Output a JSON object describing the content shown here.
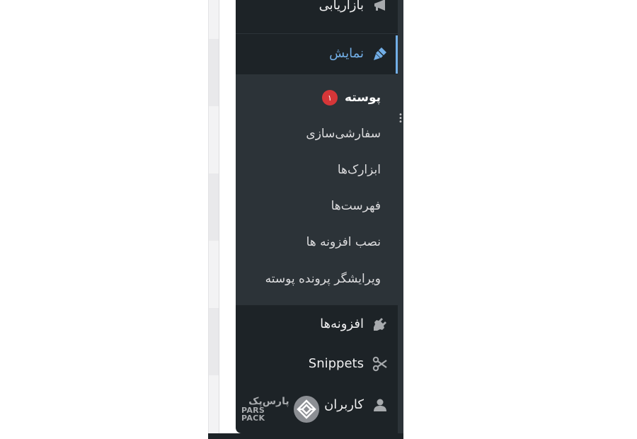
{
  "menu": {
    "top_item": {
      "label": "بازاریابی",
      "icon": "megaphone-icon"
    },
    "active_item": {
      "label": "نمایش",
      "icon": "paintbrush-icon"
    },
    "submenu": [
      {
        "label": "پوسته",
        "badge": "۱"
      },
      {
        "label": "سفارشی‌سازی"
      },
      {
        "label": "ابزارک‌ها"
      },
      {
        "label": "فهرست‌ها"
      },
      {
        "label": "نصب افزونه ها"
      },
      {
        "label": "ویرایشگر پرونده پوسته"
      }
    ],
    "items": [
      {
        "label": "افزونه‌ها",
        "icon": "plugin-icon"
      },
      {
        "label": "Snippets",
        "icon": "scissors-icon"
      },
      {
        "label": "کاربران",
        "icon": "user-icon"
      }
    ]
  },
  "watermark": {
    "fa": "پارس‌پک",
    "en": "PARS PACK"
  },
  "colors": {
    "menu_bg": "#1d2327",
    "submenu_bg": "#2c3338",
    "accent": "#72aee6",
    "badge": "#d63638"
  }
}
